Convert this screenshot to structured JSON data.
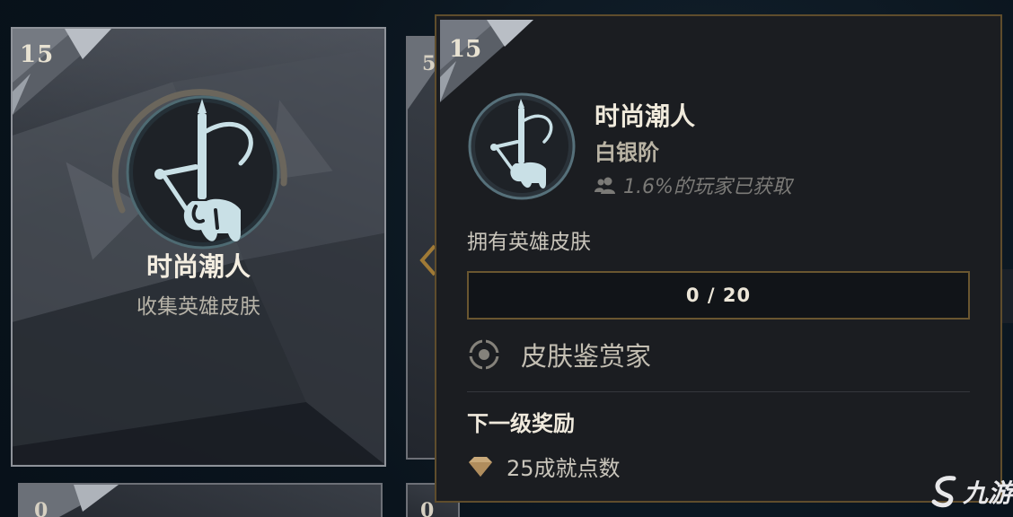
{
  "card": {
    "level": "15",
    "title": "时尚潮人",
    "subtitle": "收集英雄皮肤",
    "icon": "fashion-emblem-icon"
  },
  "background_cards": {
    "right_top_level": "5",
    "bottom_left_level": "0",
    "bottom_middle_level": "0"
  },
  "tooltip": {
    "level": "15",
    "title": "时尚潮人",
    "tier": "白银阶",
    "players": "1.6%的玩家已获取",
    "players_icon": "players-icon",
    "description": "拥有英雄皮肤",
    "progress": {
      "current": 0,
      "total": 20,
      "text": "0 / 20",
      "fraction": 0.0
    },
    "title_reward": {
      "icon": "title-target-icon",
      "label": "皮肤鉴赏家"
    },
    "next_reward_label": "下一级奖励",
    "reward": {
      "icon": "gem-icon",
      "label": "25成就点数"
    }
  },
  "watermark": {
    "text": "九游"
  },
  "colors": {
    "accent_gold": "#6a5630",
    "emblem_ice": "#c9e0e6",
    "background": "#0b1520"
  }
}
